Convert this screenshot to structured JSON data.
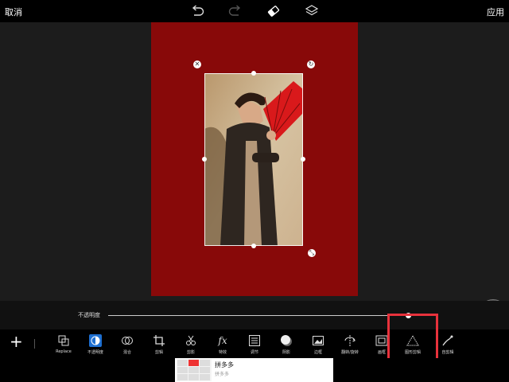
{
  "header": {
    "cancel": "取消",
    "apply": "应用"
  },
  "opacity": {
    "label": "不透明度",
    "value": 0.98,
    "dots": "···"
  },
  "toolbar": {
    "items": [
      {
        "label": "Replace"
      },
      {
        "label": "不透明度"
      },
      {
        "label": "混合"
      },
      {
        "label": "剪辑"
      },
      {
        "label": "剪影"
      },
      {
        "label": "特效"
      },
      {
        "label": "调节"
      },
      {
        "label": "阴影"
      },
      {
        "label": "边框"
      },
      {
        "label": "翻转/旋转"
      },
      {
        "label": "画框"
      },
      {
        "label": "图形剪辑"
      },
      {
        "label": "自剪辑"
      }
    ],
    "highlighted": "图形剪辑"
  },
  "ad": {
    "title": "拼多多",
    "subtitle": "拼多多"
  },
  "colors": {
    "artboard": "#880909",
    "highlight": "#e8323c",
    "selected_tool": "#1e6fd0"
  },
  "icons": [
    "undo-icon",
    "redo-icon",
    "eraser-icon",
    "layers-icon",
    "plus-icon",
    "dpad-icon"
  ]
}
